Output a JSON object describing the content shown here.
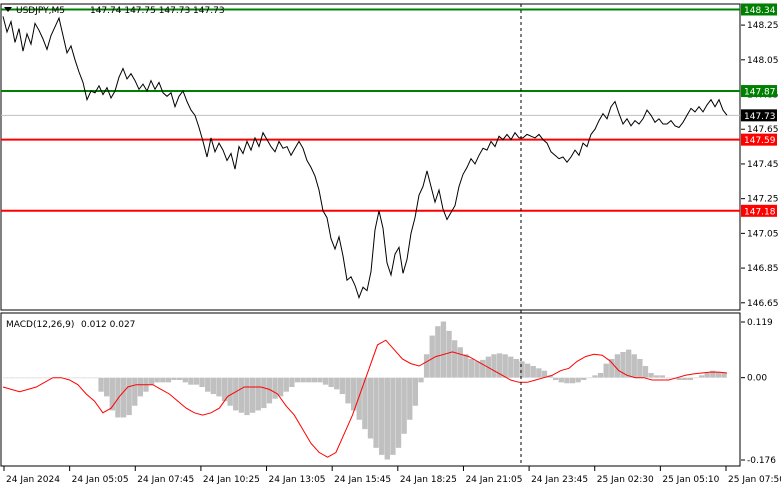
{
  "header": {
    "symbol_label": "USDJPY,M5",
    "ohlc_label": "147.74 147.75 147.73 147.73"
  },
  "macd_header": {
    "label": "MACD(12,26,9)",
    "values_label": "0.012 0.027"
  },
  "colors": {
    "background": "#ffffff",
    "price_line": "#000000",
    "resistance": "#008000",
    "support": "#ff0000",
    "histogram": "#c0c0c0",
    "signal": "#ff0000",
    "grid": "#000000",
    "current_price_bg": "#000000",
    "label_text": "#ffffff"
  },
  "chart_data": [
    {
      "type": "line",
      "title": "USDJPY,M5",
      "x_ticks": [
        "24 Jan 2024",
        "24 Jan 05:05",
        "24 Jan 07:45",
        "24 Jan 10:25",
        "24 Jan 13:05",
        "24 Jan 15:45",
        "24 Jan 18:25",
        "24 Jan 21:05",
        "24 Jan 23:45",
        "25 Jan 02:30",
        "25 Jan 05:10",
        "25 Jan 07:50"
      ],
      "y_ticks": [
        148.25,
        148.05,
        147.85,
        147.65,
        147.45,
        147.25,
        147.05,
        146.85,
        146.65
      ],
      "ylim": [
        146.62,
        148.36
      ],
      "vertical_marker_x": "24 Jan 23:45",
      "levels": [
        {
          "value": "148.34",
          "color": "resistance"
        },
        {
          "value": "147.87",
          "color": "resistance"
        },
        {
          "value": "147.59",
          "color": "support"
        },
        {
          "value": "147.18",
          "color": "support"
        }
      ],
      "current_price": "147.73",
      "series": [
        {
          "values": [
            148.3,
            148.21,
            148.27,
            148.15,
            148.23,
            148.1,
            148.2,
            148.14,
            148.26,
            148.22,
            148.17,
            148.11,
            148.19,
            148.24,
            148.29,
            148.19,
            148.09,
            148.13,
            148.05,
            147.98,
            147.92,
            147.82,
            147.87,
            147.86,
            147.9,
            147.85,
            147.89,
            147.83,
            147.87,
            147.95,
            148.0,
            147.94,
            147.97,
            147.93,
            147.88,
            147.91,
            147.87,
            147.93,
            147.88,
            147.92,
            147.86,
            147.84,
            147.86,
            147.78,
            147.84,
            147.87,
            147.81,
            147.76,
            147.73,
            147.66,
            147.58,
            147.49,
            147.6,
            147.52,
            147.57,
            147.53,
            147.47,
            147.51,
            147.42,
            147.55,
            147.51,
            147.58,
            147.53,
            147.6,
            147.55,
            147.63,
            147.59,
            147.55,
            147.52,
            147.58,
            147.54,
            147.55,
            147.5,
            147.54,
            147.58,
            147.54,
            147.47,
            147.43,
            147.38,
            147.3,
            147.18,
            147.14,
            147.02,
            146.96,
            147.03,
            146.92,
            146.78,
            146.8,
            146.75,
            146.68,
            146.74,
            146.72,
            146.83,
            147.07,
            147.18,
            147.08,
            146.88,
            146.81,
            146.93,
            146.97,
            146.82,
            146.9,
            147.05,
            147.14,
            147.27,
            147.32,
            147.41,
            147.32,
            147.23,
            147.3,
            147.19,
            147.13,
            147.17,
            147.21,
            147.32,
            147.39,
            147.43,
            147.48,
            147.45,
            147.5,
            147.54,
            147.53,
            147.58,
            147.55,
            147.61,
            147.59,
            147.62,
            147.59,
            147.63,
            147.6,
            147.6,
            147.62,
            147.61,
            147.6,
            147.62,
            147.59,
            147.57,
            147.52,
            147.5,
            147.48,
            147.49,
            147.46,
            147.49,
            147.53,
            147.5,
            147.57,
            147.55,
            147.62,
            147.65,
            147.7,
            147.74,
            147.71,
            147.78,
            147.81,
            147.74,
            147.68,
            147.71,
            147.67,
            147.7,
            147.68,
            147.71,
            147.76,
            147.73,
            147.69,
            147.71,
            147.68,
            147.68,
            147.7,
            147.67,
            147.66,
            147.69,
            147.73,
            147.77,
            147.75,
            147.78,
            147.75,
            147.79,
            147.82,
            147.78,
            147.82,
            147.76,
            147.73
          ]
        }
      ]
    },
    {
      "type": "bar",
      "title": "MACD(12,26,9)",
      "y_ticks": [
        "0.119",
        "0.00",
        "-0.176"
      ],
      "ylim": [
        -0.176,
        0.119
      ],
      "series": [
        {
          "name": "MACD",
          "values": [
            0.0,
            0.0,
            0.0,
            0.0,
            0.0,
            0.0,
            0.0,
            0.0,
            0.0,
            0.0,
            0.0,
            0.0,
            0.0,
            0.0,
            0.0,
            0.0,
            0.0,
            -0.03,
            -0.04,
            -0.07,
            -0.085,
            -0.085,
            -0.08,
            -0.06,
            -0.04,
            -0.03,
            -0.015,
            -0.01,
            -0.01,
            -0.01,
            -0.005,
            -0.005,
            -0.01,
            -0.015,
            -0.015,
            -0.02,
            -0.03,
            -0.035,
            -0.04,
            -0.05,
            -0.06,
            -0.07,
            -0.075,
            -0.08,
            -0.075,
            -0.07,
            -0.065,
            -0.055,
            -0.045,
            -0.04,
            -0.03,
            -0.02,
            -0.01,
            -0.01,
            -0.01,
            -0.01,
            -0.01,
            -0.015,
            -0.02,
            -0.025,
            -0.035,
            -0.055,
            -0.07,
            -0.09,
            -0.11,
            -0.13,
            -0.15,
            -0.165,
            -0.175,
            -0.165,
            -0.15,
            -0.12,
            -0.09,
            -0.06,
            -0.01,
            0.05,
            0.09,
            0.11,
            0.12,
            0.1,
            0.08,
            0.065,
            0.05,
            0.04,
            0.035,
            0.038,
            0.045,
            0.05,
            0.052,
            0.05,
            0.045,
            0.04,
            0.035,
            0.03,
            0.025,
            0.02,
            0.015,
            0.005,
            -0.005,
            -0.01,
            -0.012,
            -0.012,
            -0.01,
            -0.005,
            0.0,
            0.005,
            0.01,
            0.03,
            0.04,
            0.05,
            0.055,
            0.06,
            0.05,
            0.04,
            0.025,
            0.01,
            0.005,
            0.005,
            0.0,
            0.0,
            -0.005,
            -0.005,
            -0.005,
            0.0,
            0.005,
            0.01,
            0.015,
            0.012,
            0.01
          ]
        },
        {
          "name": "Signal",
          "values": [
            -0.02,
            -0.025,
            -0.03,
            -0.025,
            -0.02,
            -0.01,
            0.0,
            0.0,
            -0.005,
            -0.015,
            -0.035,
            -0.05,
            -0.075,
            -0.065,
            -0.04,
            -0.02,
            -0.015,
            -0.015,
            -0.015,
            -0.025,
            -0.035,
            -0.05,
            -0.065,
            -0.075,
            -0.08,
            -0.075,
            -0.065,
            -0.04,
            -0.03,
            -0.02,
            -0.02,
            -0.02,
            -0.025,
            -0.035,
            -0.06,
            -0.08,
            -0.11,
            -0.14,
            -0.16,
            -0.17,
            -0.16,
            -0.12,
            -0.08,
            -0.03,
            0.02,
            0.07,
            0.08,
            0.06,
            0.04,
            0.03,
            0.025,
            0.035,
            0.045,
            0.05,
            0.055,
            0.05,
            0.045,
            0.035,
            0.025,
            0.015,
            0.005,
            -0.005,
            -0.01,
            -0.01,
            -0.005,
            0.0,
            0.005,
            0.015,
            0.02,
            0.035,
            0.045,
            0.05,
            0.048,
            0.035,
            0.015,
            0.005,
            0.0,
            0.0,
            -0.005,
            -0.005,
            -0.005,
            0.0,
            0.005,
            0.008,
            0.01,
            0.012,
            0.012,
            0.01
          ]
        }
      ]
    }
  ]
}
